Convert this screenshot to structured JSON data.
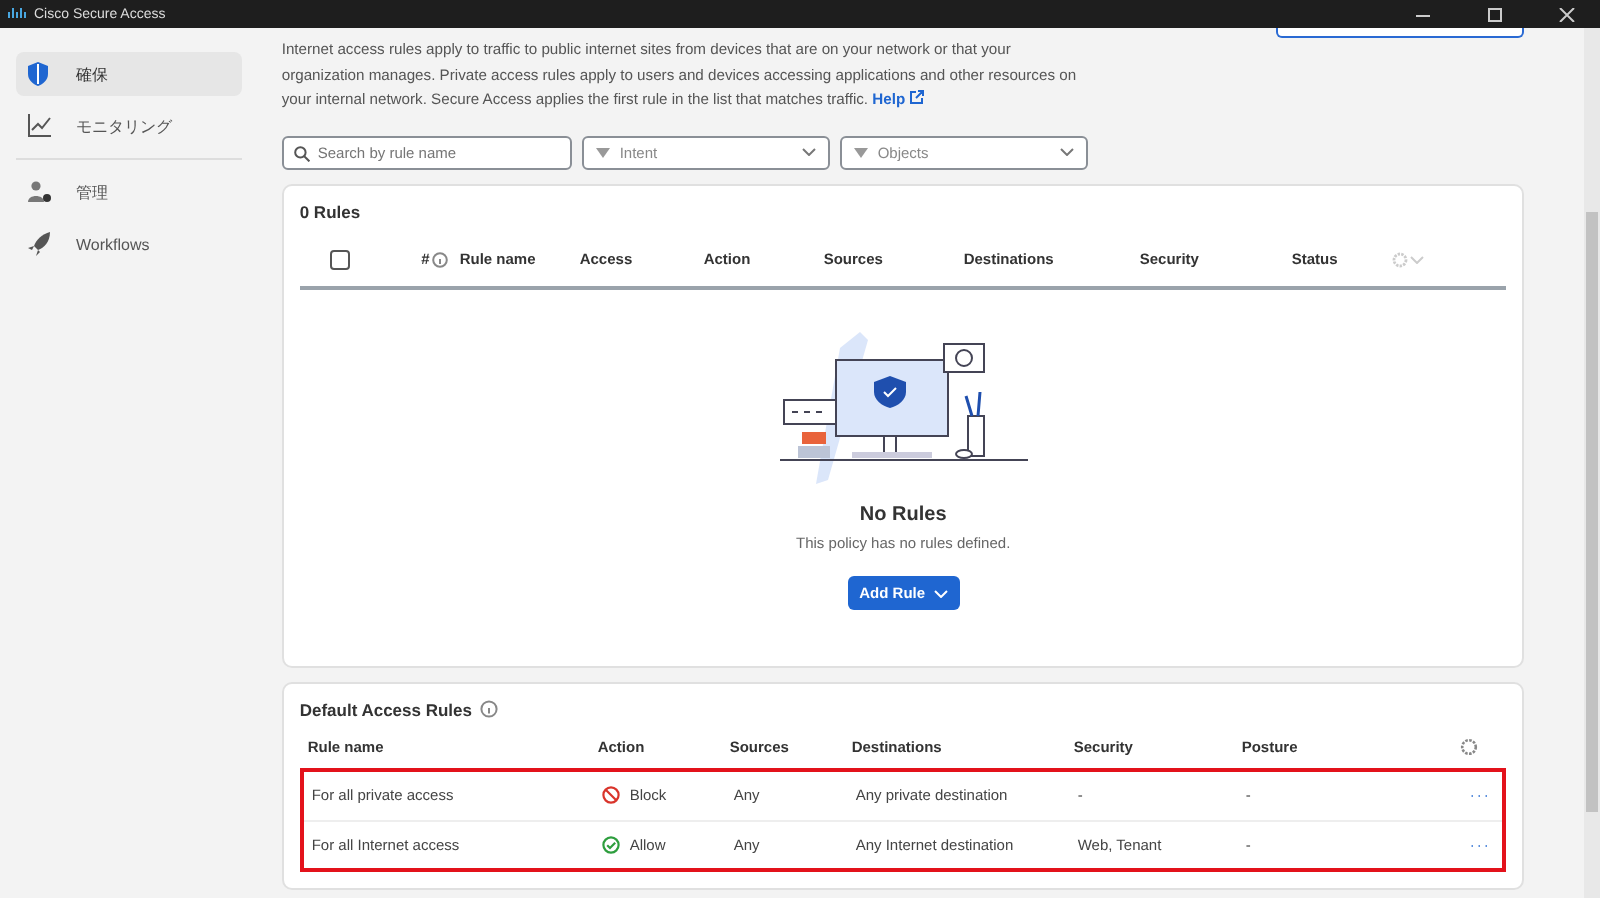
{
  "window": {
    "title": "Cisco Secure Access"
  },
  "sidebar": {
    "items": [
      {
        "label": "確保",
        "selected": true
      },
      {
        "label": "モニタリング",
        "selected": false
      },
      {
        "label": "管理",
        "selected": false
      },
      {
        "label": "Workflows",
        "selected": false
      }
    ]
  },
  "description": {
    "text": "Internet access rules apply to traffic to public internet sites from devices that are on your network or that your organization manages. Private access rules apply to users and devices accessing applications and other resources on your internal network. Secure Access applies the first rule in the list that matches traffic.",
    "link": "Help"
  },
  "filters": {
    "search_placeholder": "Search by rule name",
    "dropdowns": [
      "Intent",
      "Objects"
    ]
  },
  "rules": {
    "count": "0 Rules",
    "select_all_checked": false,
    "columns": [
      "#",
      "Rule name",
      "Access",
      "Action",
      "Sources",
      "Destinations",
      "Security",
      "Status"
    ],
    "empty_title": "No Rules",
    "empty_text": "This policy has no rules defined.",
    "add_button": "Add Rule"
  },
  "default_rules": {
    "title": "Default Access Rules",
    "highlighted": true,
    "columns": [
      "Rule name",
      "Action",
      "Sources",
      "Destinations",
      "Security",
      "Posture"
    ],
    "rows": [
      {
        "name": "For all private access",
        "action": {
          "kind": "block",
          "label": "Block"
        },
        "sources": "Any",
        "destinations": "Any private destination",
        "security": "-",
        "posture": "-",
        "more": "···"
      },
      {
        "name": "For all Internet access",
        "action": {
          "kind": "allow",
          "label": "Allow"
        },
        "sources": "Any",
        "destinations": "Any Internet destination",
        "security": "Web, Tenant",
        "posture": "-",
        "more": "···"
      }
    ]
  }
}
